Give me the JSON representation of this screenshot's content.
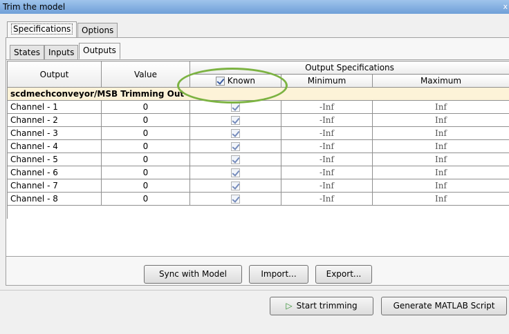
{
  "window": {
    "title": "Trim the model",
    "close_glyph": "x"
  },
  "top_tabs": [
    {
      "label": "Specifications",
      "active": true
    },
    {
      "label": "Options",
      "active": false
    }
  ],
  "sub_tabs": [
    {
      "label": "States",
      "active": false
    },
    {
      "label": "Inputs",
      "active": false
    },
    {
      "label": "Outputs",
      "active": true
    }
  ],
  "table": {
    "headers": {
      "output": "Output",
      "value": "Value",
      "group": "Output Specifications",
      "known": "Known",
      "minimum": "Minimum",
      "maximum": "Maximum"
    },
    "block_name": "scdmechconveyor/MSB Trimming Out",
    "rows": [
      {
        "output": "Channel - 1",
        "value": "0",
        "known": true,
        "minimum": "-Inf",
        "maximum": "Inf"
      },
      {
        "output": "Channel - 2",
        "value": "0",
        "known": true,
        "minimum": "-Inf",
        "maximum": "Inf"
      },
      {
        "output": "Channel - 3",
        "value": "0",
        "known": true,
        "minimum": "-Inf",
        "maximum": "Inf"
      },
      {
        "output": "Channel - 4",
        "value": "0",
        "known": true,
        "minimum": "-Inf",
        "maximum": "Inf"
      },
      {
        "output": "Channel - 5",
        "value": "0",
        "known": true,
        "minimum": "-Inf",
        "maximum": "Inf"
      },
      {
        "output": "Channel - 6",
        "value": "0",
        "known": true,
        "minimum": "-Inf",
        "maximum": "Inf"
      },
      {
        "output": "Channel - 7",
        "value": "0",
        "known": true,
        "minimum": "-Inf",
        "maximum": "Inf"
      },
      {
        "output": "Channel - 8",
        "value": "0",
        "known": true,
        "minimum": "-Inf",
        "maximum": "Inf"
      }
    ]
  },
  "buttons": {
    "sync": "Sync with Model",
    "import": "Import...",
    "export": "Export...",
    "start": "Start trimming",
    "generate": "Generate MATLAB Script"
  },
  "colors": {
    "highlight": "#7cb342",
    "group_row_bg": "#fdf3d8"
  },
  "icons": {
    "start": "play-icon",
    "checkbox": "checkbox-checked-icon"
  }
}
